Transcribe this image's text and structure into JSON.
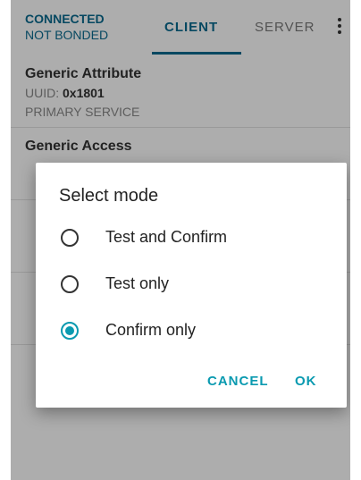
{
  "header": {
    "status_line1": "CONNECTED",
    "status_line2": "NOT BONDED",
    "tabs": [
      {
        "label": "CLIENT"
      },
      {
        "label": "SERVER"
      }
    ]
  },
  "services": [
    {
      "name": "Generic Attribute",
      "uuid_prefix": "UUID: ",
      "uuid_value": "0x1801",
      "type": "PRIMARY SERVICE"
    },
    {
      "name": "Generic Access",
      "uuid_prefix": "",
      "uuid_value": "",
      "type": ""
    },
    {
      "name": "",
      "uuid_prefix": "",
      "uuid_value": "",
      "type": ""
    },
    {
      "name": "",
      "uuid_prefix": "",
      "uuid_value": "",
      "type": ""
    }
  ],
  "dialog": {
    "title": "Select mode",
    "options": [
      {
        "label": "Test and Confirm",
        "checked": false
      },
      {
        "label": "Test only",
        "checked": false
      },
      {
        "label": "Confirm only",
        "checked": true
      }
    ],
    "cancel_label": "CANCEL",
    "ok_label": "OK"
  },
  "colors": {
    "accent": "#0a9ab0",
    "header_text": "#0a6b8f"
  }
}
